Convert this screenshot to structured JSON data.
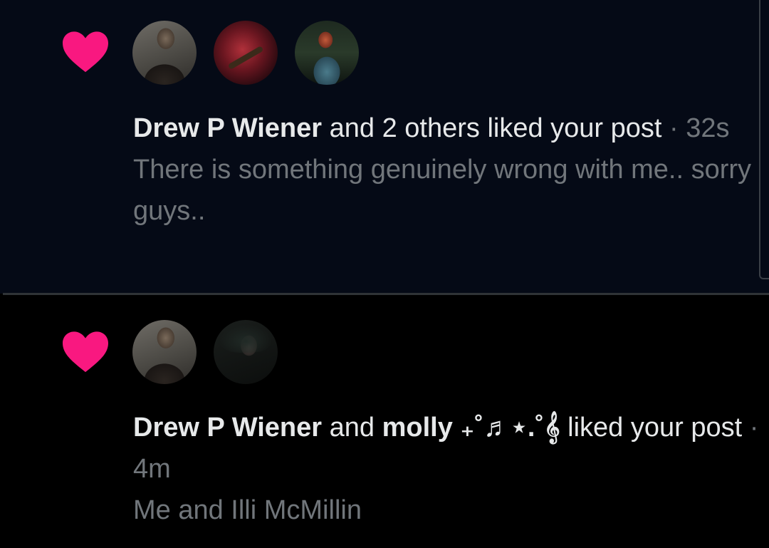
{
  "notifications": [
    {
      "type": "like",
      "icon": "heart-icon",
      "icon_color": "#f91880",
      "avatars": [
        "Drew P Wiener",
        "",
        ""
      ],
      "actor": "Drew P Wiener",
      "connector": " and 2 others liked your post",
      "separator": " · ",
      "time": "32s",
      "preview": "There is something genuinely wrong with me.. sorry guys.."
    },
    {
      "type": "like",
      "icon": "heart-icon",
      "icon_color": "#f91880",
      "avatars": [
        "Drew P Wiener",
        "molly"
      ],
      "actor": "Drew P Wiener",
      "connector_and": " and ",
      "actor2": "molly ₊˚♬⋆.˚𝄞",
      "connector": " liked your post",
      "separator": " · ",
      "time": "4m",
      "preview": "Me and Illi McMillin"
    }
  ],
  "colors": {
    "unread_bg": "#050a16",
    "read_bg": "#000000",
    "primary_text": "#e7e9ea",
    "secondary_text": "#71767b",
    "divider": "#2f3336"
  }
}
